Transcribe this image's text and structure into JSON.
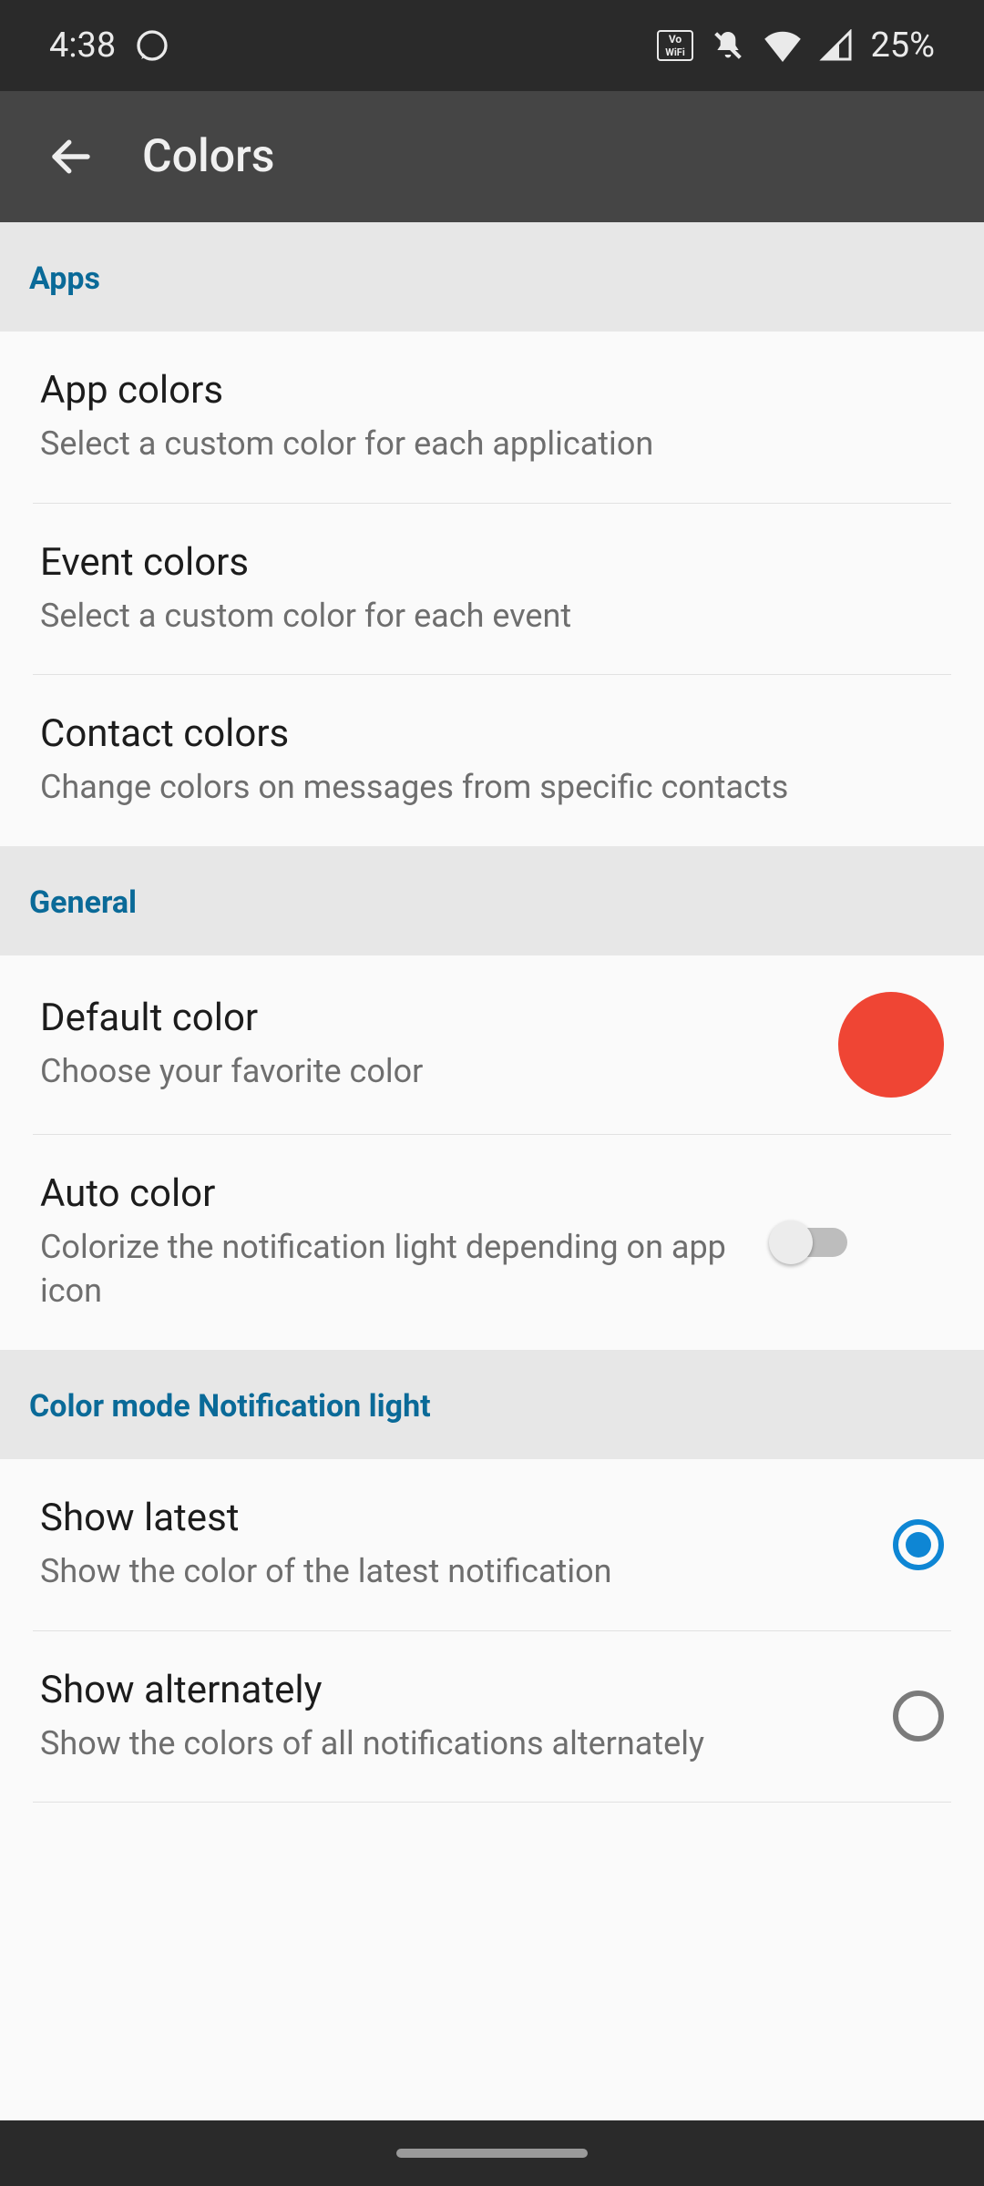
{
  "status": {
    "time": "4:38",
    "battery_text": "25%"
  },
  "appbar": {
    "title": "Colors"
  },
  "sections": {
    "apps": {
      "header": "Apps",
      "items": [
        {
          "title": "App colors",
          "subtitle": "Select a custom color for each application"
        },
        {
          "title": "Event colors",
          "subtitle": "Select a custom color for each event"
        },
        {
          "title": "Contact colors",
          "subtitle": "Change colors on messages from specific contacts"
        }
      ]
    },
    "general": {
      "header": "General",
      "default_color": {
        "title": "Default color",
        "subtitle": "Choose your favorite color",
        "swatch": "#ef4534"
      },
      "auto_color": {
        "title": "Auto color",
        "subtitle": "Colorize the notification light depending on app icon",
        "enabled": false
      }
    },
    "color_mode": {
      "header": "Color mode Notification light",
      "options": [
        {
          "title": "Show latest",
          "subtitle": "Show the color of the latest notification",
          "selected": true
        },
        {
          "title": "Show alternately",
          "subtitle": "Show the colors of all notifications alternately",
          "selected": false
        }
      ]
    }
  }
}
